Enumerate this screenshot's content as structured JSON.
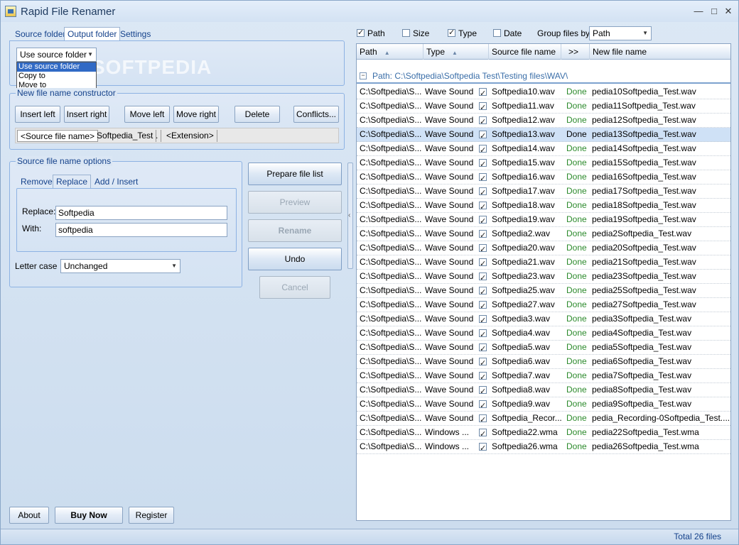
{
  "window": {
    "title": "Rapid File Renamer",
    "minimize": "—",
    "maximize": "□",
    "close": "✕"
  },
  "left_tabs": {
    "source": "Source folder",
    "output": "Output folder",
    "settings": "Settings"
  },
  "output_folder": {
    "selected": "Use source folder",
    "options": [
      "Use source folder",
      "Copy to",
      "Move to"
    ],
    "watermark": "SOFTPEDIA"
  },
  "constructor": {
    "title": "New file name constructor",
    "buttons": {
      "insert_left": "Insert left",
      "insert_right": "Insert right",
      "move_left": "Move left",
      "move_right": "Move right",
      "delete": "Delete",
      "conflicts": "Conflicts..."
    },
    "tokens": [
      "<Source file name>",
      "Softpedia_Test",
      ".",
      "<Extension>"
    ]
  },
  "source_options": {
    "title": "Source file name options",
    "tabs": {
      "remove": "Remove",
      "replace": "Replace",
      "add_insert": "Add / Insert"
    },
    "replace_label": "Replace:",
    "replace_value": "Softpedia",
    "with_label": "With:",
    "with_value": "softpedia",
    "letter_case_label": "Letter case",
    "letter_case_value": "Unchanged"
  },
  "actions": {
    "prepare": "Prepare file list",
    "preview": "Preview",
    "rename": "Rename",
    "undo": "Undo",
    "cancel": "Cancel"
  },
  "bottom_buttons": {
    "about": "About",
    "buy": "Buy Now",
    "register": "Register"
  },
  "column_toggles": {
    "path": "Path",
    "path_checked": true,
    "size": "Size",
    "size_checked": false,
    "type": "Type",
    "type_checked": true,
    "date": "Date",
    "date_checked": false,
    "group_label": "Group files by",
    "group_value": "Path"
  },
  "grid": {
    "headers": {
      "path": "Path",
      "type": "Type",
      "source": "Source file name",
      "arrows": ">>",
      "new": "New file name"
    },
    "group_label": "Path: C:\\Softpedia\\Softpedia Test\\Testing files\\WAV\\",
    "group_toggle": "−",
    "rows": [
      {
        "path": "C:\\Softpedia\\S...",
        "type": "Wave Sound",
        "source": "Softpedia10.wav",
        "status": "Done",
        "new": "pedia10Softpedia_Test.wav"
      },
      {
        "path": "C:\\Softpedia\\S...",
        "type": "Wave Sound",
        "source": "Softpedia11.wav",
        "status": "Done",
        "new": "pedia11Softpedia_Test.wav"
      },
      {
        "path": "C:\\Softpedia\\S...",
        "type": "Wave Sound",
        "source": "Softpedia12.wav",
        "status": "Done",
        "new": "pedia12Softpedia_Test.wav"
      },
      {
        "path": "C:\\Softpedia\\S...",
        "type": "Wave Sound",
        "source": "Softpedia13.wav",
        "status": "Done",
        "new": "pedia13Softpedia_Test.wav"
      },
      {
        "path": "C:\\Softpedia\\S...",
        "type": "Wave Sound",
        "source": "Softpedia14.wav",
        "status": "Done",
        "new": "pedia14Softpedia_Test.wav"
      },
      {
        "path": "C:\\Softpedia\\S...",
        "type": "Wave Sound",
        "source": "Softpedia15.wav",
        "status": "Done",
        "new": "pedia15Softpedia_Test.wav"
      },
      {
        "path": "C:\\Softpedia\\S...",
        "type": "Wave Sound",
        "source": "Softpedia16.wav",
        "status": "Done",
        "new": "pedia16Softpedia_Test.wav"
      },
      {
        "path": "C:\\Softpedia\\S...",
        "type": "Wave Sound",
        "source": "Softpedia17.wav",
        "status": "Done",
        "new": "pedia17Softpedia_Test.wav"
      },
      {
        "path": "C:\\Softpedia\\S...",
        "type": "Wave Sound",
        "source": "Softpedia18.wav",
        "status": "Done",
        "new": "pedia18Softpedia_Test.wav"
      },
      {
        "path": "C:\\Softpedia\\S...",
        "type": "Wave Sound",
        "source": "Softpedia19.wav",
        "status": "Done",
        "new": "pedia19Softpedia_Test.wav"
      },
      {
        "path": "C:\\Softpedia\\S...",
        "type": "Wave Sound",
        "source": "Softpedia2.wav",
        "status": "Done",
        "new": "pedia2Softpedia_Test.wav"
      },
      {
        "path": "C:\\Softpedia\\S...",
        "type": "Wave Sound",
        "source": "Softpedia20.wav",
        "status": "Done",
        "new": "pedia20Softpedia_Test.wav"
      },
      {
        "path": "C:\\Softpedia\\S...",
        "type": "Wave Sound",
        "source": "Softpedia21.wav",
        "status": "Done",
        "new": "pedia21Softpedia_Test.wav"
      },
      {
        "path": "C:\\Softpedia\\S...",
        "type": "Wave Sound",
        "source": "Softpedia23.wav",
        "status": "Done",
        "new": "pedia23Softpedia_Test.wav"
      },
      {
        "path": "C:\\Softpedia\\S...",
        "type": "Wave Sound",
        "source": "Softpedia25.wav",
        "status": "Done",
        "new": "pedia25Softpedia_Test.wav"
      },
      {
        "path": "C:\\Softpedia\\S...",
        "type": "Wave Sound",
        "source": "Softpedia27.wav",
        "status": "Done",
        "new": "pedia27Softpedia_Test.wav"
      },
      {
        "path": "C:\\Softpedia\\S...",
        "type": "Wave Sound",
        "source": "Softpedia3.wav",
        "status": "Done",
        "new": "pedia3Softpedia_Test.wav"
      },
      {
        "path": "C:\\Softpedia\\S...",
        "type": "Wave Sound",
        "source": "Softpedia4.wav",
        "status": "Done",
        "new": "pedia4Softpedia_Test.wav"
      },
      {
        "path": "C:\\Softpedia\\S...",
        "type": "Wave Sound",
        "source": "Softpedia5.wav",
        "status": "Done",
        "new": "pedia5Softpedia_Test.wav"
      },
      {
        "path": "C:\\Softpedia\\S...",
        "type": "Wave Sound",
        "source": "Softpedia6.wav",
        "status": "Done",
        "new": "pedia6Softpedia_Test.wav"
      },
      {
        "path": "C:\\Softpedia\\S...",
        "type": "Wave Sound",
        "source": "Softpedia7.wav",
        "status": "Done",
        "new": "pedia7Softpedia_Test.wav"
      },
      {
        "path": "C:\\Softpedia\\S...",
        "type": "Wave Sound",
        "source": "Softpedia8.wav",
        "status": "Done",
        "new": "pedia8Softpedia_Test.wav"
      },
      {
        "path": "C:\\Softpedia\\S...",
        "type": "Wave Sound",
        "source": "Softpedia9.wav",
        "status": "Done",
        "new": "pedia9Softpedia_Test.wav"
      },
      {
        "path": "C:\\Softpedia\\S...",
        "type": "Wave Sound",
        "source": "Softpedia_Recor...",
        "status": "Done",
        "new": "pedia_Recording-0Softpedia_Test...."
      },
      {
        "path": "C:\\Softpedia\\S...",
        "type": "Windows ...",
        "source": "Softpedia22.wma",
        "status": "Done",
        "new": "pedia22Softpedia_Test.wma"
      },
      {
        "path": "C:\\Softpedia\\S...",
        "type": "Windows ...",
        "source": "Softpedia26.wma",
        "status": "Done",
        "new": "pedia26Softpedia_Test.wma"
      }
    ],
    "selected_row": 3
  },
  "status_bar": {
    "total": "Total 26 files"
  },
  "splitter_arrow": "‹"
}
